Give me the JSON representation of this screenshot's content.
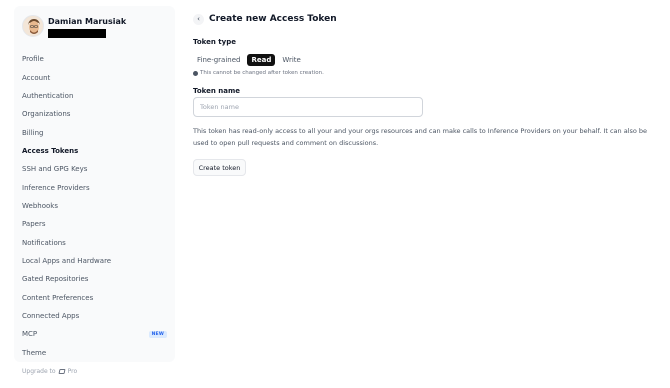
{
  "sidebar": {
    "user_name": "Damian Marusiak",
    "items": [
      {
        "label": "Profile"
      },
      {
        "label": "Account"
      },
      {
        "label": "Authentication"
      },
      {
        "label": "Organizations"
      },
      {
        "label": "Billing"
      },
      {
        "label": "Access Tokens",
        "active": true
      },
      {
        "label": "SSH and GPG Keys"
      },
      {
        "label": "Inference Providers"
      },
      {
        "label": "Webhooks"
      },
      {
        "label": "Papers"
      },
      {
        "label": "Notifications"
      },
      {
        "label": "Local Apps and Hardware"
      },
      {
        "label": "Gated Repositories"
      },
      {
        "label": "Content Preferences"
      },
      {
        "label": "Connected Apps"
      },
      {
        "label": "MCP",
        "badge": "NEW"
      },
      {
        "label": "Theme"
      }
    ],
    "upgrade_prefix": "Upgrade to",
    "upgrade_plan": "Pro"
  },
  "main": {
    "title": "Create new Access Token",
    "token_type_label": "Token type",
    "tabs": [
      {
        "label": "Fine-grained"
      },
      {
        "label": "Read",
        "selected": true
      },
      {
        "label": "Write"
      }
    ],
    "note": "This cannot be changed after token creation.",
    "token_name_label": "Token name",
    "token_name_placeholder": "Token name",
    "token_name_value": "",
    "description": "This token has read-only access to all your and your orgs resources and can make calls to Inference Providers on your behalf. It can also be used to open pull requests and comment on discussions.",
    "create_button": "Create token"
  }
}
